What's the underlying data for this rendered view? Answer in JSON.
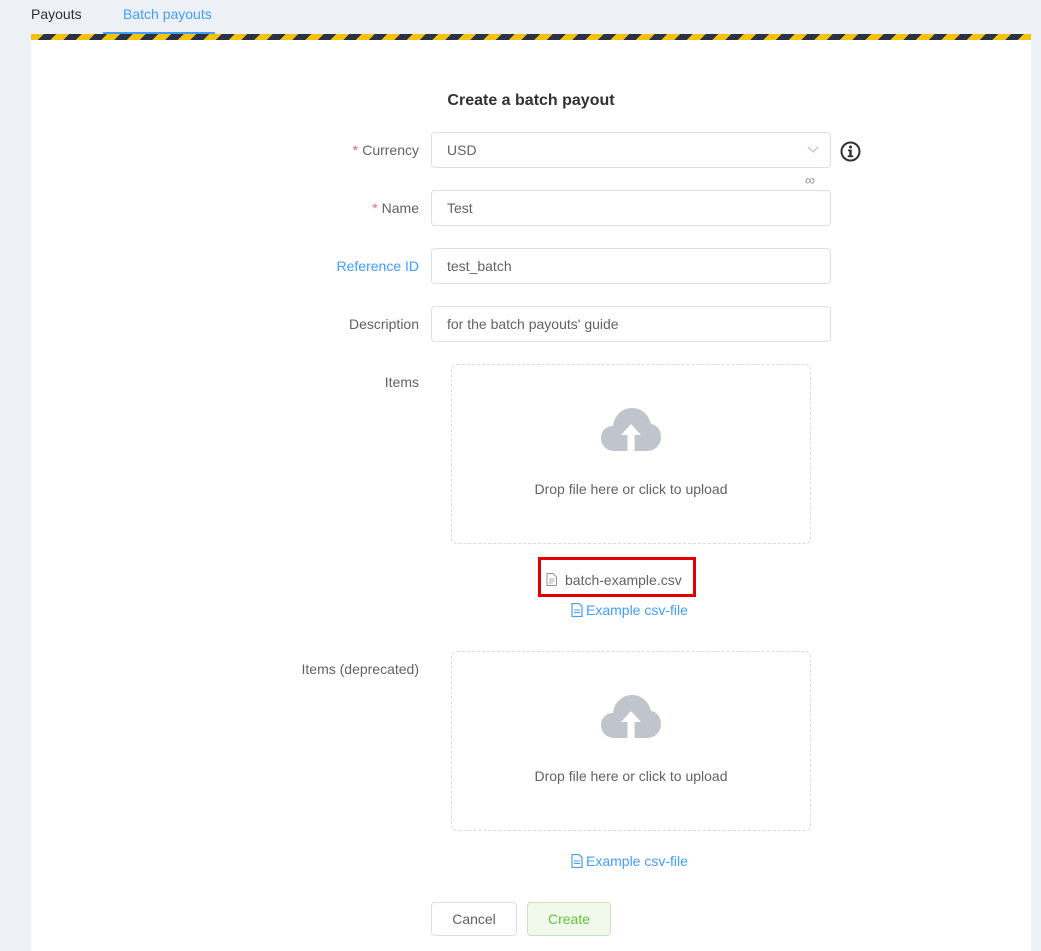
{
  "tabs": [
    {
      "label": "Payouts",
      "active": false
    },
    {
      "label": "Batch payouts",
      "active": true
    }
  ],
  "form": {
    "title": "Create a batch payout",
    "required_marker": "*",
    "currency": {
      "label": "Currency",
      "value": "USD",
      "extra_icon": "infinity-icon",
      "help_icon": "info-icon"
    },
    "name": {
      "label": "Name",
      "value": "Test"
    },
    "reference_id": {
      "label": "Reference ID",
      "value": "test_batch"
    },
    "description": {
      "label": "Description",
      "value": "for the batch payouts' guide"
    },
    "items": {
      "label": "Items",
      "upload_text": "Drop file here or click to upload",
      "file_name": "batch-example.csv",
      "example_link": "Example csv-file"
    },
    "items_deprecated": {
      "label": "Items (deprecated)",
      "upload_text": "Drop file here or click to upload",
      "example_link": "Example csv-file"
    }
  },
  "buttons": {
    "cancel": "Cancel",
    "create": "Create"
  },
  "colors": {
    "accent": "#409eff",
    "required": "#f56c6c",
    "success": "#67c23a",
    "highlight_box": "#e00000",
    "stripe_yellow": "#f4c20d",
    "stripe_dark": "#2b3244"
  }
}
